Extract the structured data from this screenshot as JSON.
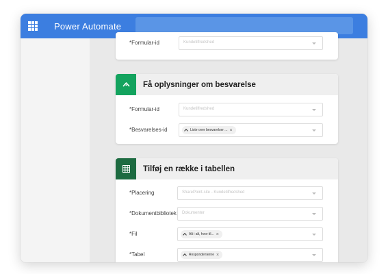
{
  "app": {
    "title": "Power Automate"
  },
  "colors": {
    "topbar": "#3c7ee0",
    "forms_green": "#13a35e",
    "excel_green": "#1d6b41"
  },
  "card_top": {
    "formular_label": "*Formular-id",
    "formular_placeholder": "Kundetilfredshed"
  },
  "card_forms": {
    "icon": "forms-icon",
    "title": "Få oplysninger om besvarelse",
    "formular_label": "*Formular-id",
    "formular_placeholder": "Kundetilfredshed",
    "besvarelse_label": "*Besvarelses-id",
    "besvarelse_token": "Liste over besvarelser ..."
  },
  "card_excel": {
    "icon": "excel-table-icon",
    "title": "Tilføj en række i tabellen",
    "placering_label": "*Placering",
    "placering_placeholder": "SharePoint-site - Kundetilfredshed",
    "dokument_label": "*Dokumentbibliotek",
    "dokument_placeholder": "Dokumenter",
    "fil_label": "*Fil",
    "fil_token": "Alt i alt, hvor til...",
    "tabel_label": "*Tabel",
    "tabel_token": "Respondenterne"
  }
}
